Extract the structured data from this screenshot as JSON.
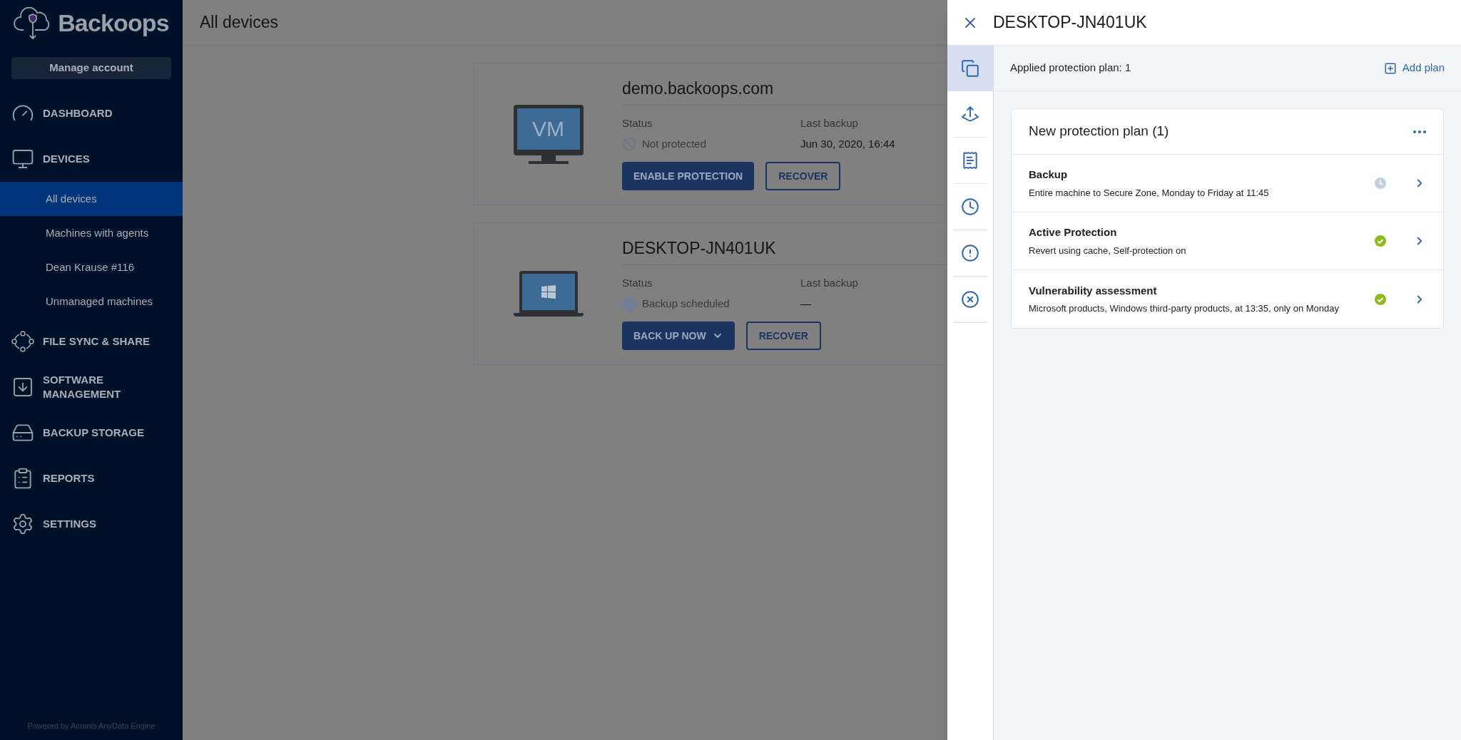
{
  "sidebar": {
    "logo": "Backoops",
    "manage_account": "Manage account",
    "items": [
      {
        "label": "DASHBOARD",
        "kind": "section",
        "selected": false
      },
      {
        "label": "DEVICES",
        "kind": "section",
        "selected": false
      },
      {
        "label": "All devices",
        "kind": "subitem",
        "selected": true
      },
      {
        "label": "Machines with agents",
        "kind": "subitem",
        "selected": false
      },
      {
        "label": "Dean Krause #116",
        "kind": "subitem",
        "selected": false
      },
      {
        "label": "Unmanaged machines",
        "kind": "subitem",
        "selected": false
      },
      {
        "label": "FILE SYNC & SHARE",
        "kind": "section",
        "selected": false
      },
      {
        "label": "SOFTWARE MANAGEMENT",
        "kind": "section",
        "selected": false
      },
      {
        "label": "BACKUP STORAGE",
        "kind": "section",
        "selected": false
      },
      {
        "label": "REPORTS",
        "kind": "section",
        "selected": false
      },
      {
        "label": "SETTINGS",
        "kind": "section",
        "selected": false
      }
    ],
    "footer": "Powered by Acronis AnyData Engine"
  },
  "page_title": "All devices",
  "devices": [
    {
      "name": "demo.backoops.com",
      "kind": "vm",
      "vm_label": "VM",
      "status_label": "Status",
      "status": {
        "label": "Not protected",
        "kind": "not_protected"
      },
      "last_backup_label": "Last backup",
      "last_backup": "Jun 30, 2020, 16:44",
      "buttons": [
        {
          "label": "ENABLE PROTECTION",
          "kind": "primary"
        },
        {
          "label": "RECOVER",
          "kind": "outline"
        }
      ]
    },
    {
      "name": "DESKTOP-JN401UK",
      "kind": "laptop",
      "status_label": "Status",
      "status": {
        "label": "Backup scheduled",
        "kind": "scheduled"
      },
      "last_backup_label": "Last backup",
      "last_backup": "—",
      "buttons": [
        {
          "label": "BACK UP NOW",
          "kind": "primary_dropdown"
        },
        {
          "label": "RECOVER",
          "kind": "outline"
        }
      ]
    }
  ],
  "panel": {
    "title": "DESKTOP-JN401UK",
    "tabs": [
      {
        "selected": true
      },
      {
        "selected": false
      },
      {
        "selected": false
      },
      {
        "selected": false
      },
      {
        "selected": false
      },
      {
        "selected": false
      }
    ],
    "applied": "Applied protection plan: 1",
    "add_plan": "Add plan",
    "plan": {
      "title": "New protection plan (1)",
      "modules": [
        {
          "title": "Backup",
          "description": "Entire machine to Secure Zone, Monday to Friday at 11:45",
          "kind": "scheduled"
        },
        {
          "title": "Active Protection",
          "description": "Revert using cache, Self-protection on",
          "kind": "ok"
        },
        {
          "title": "Vulnerability assessment",
          "description": "Microsoft products, Windows third-party products, at 13:35, only on Monday",
          "kind": "ok"
        }
      ]
    }
  }
}
